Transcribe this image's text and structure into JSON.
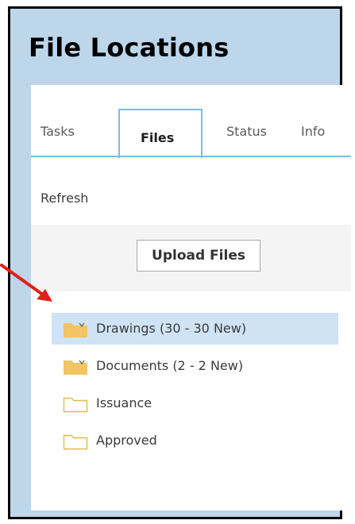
{
  "page": {
    "title": "File Locations"
  },
  "tabs": [
    {
      "label": "Tasks",
      "active": false
    },
    {
      "label": "Files",
      "active": true
    },
    {
      "label": "Status",
      "active": false
    },
    {
      "label": "Info",
      "active": false
    }
  ],
  "toolbar": {
    "refresh_label": "Refresh",
    "upload_label": "Upload Files"
  },
  "tree": {
    "items": [
      {
        "label": "Drawings (30 - 30 New)",
        "icon": "folder-filled-icon",
        "selected": true
      },
      {
        "label": "Documents (2 - 2 New)",
        "icon": "folder-filled-icon",
        "selected": false
      },
      {
        "label": "Issuance",
        "icon": "folder-empty-icon",
        "selected": false
      },
      {
        "label": "Approved",
        "icon": "folder-empty-icon",
        "selected": false
      }
    ]
  },
  "colors": {
    "frame_background": "#bdd6ea",
    "accent_blue": "#7fbbe2",
    "selection": "#cfe3f5",
    "folder_yellow": "#f2c463",
    "annotation_arrow": "#e0201b"
  }
}
